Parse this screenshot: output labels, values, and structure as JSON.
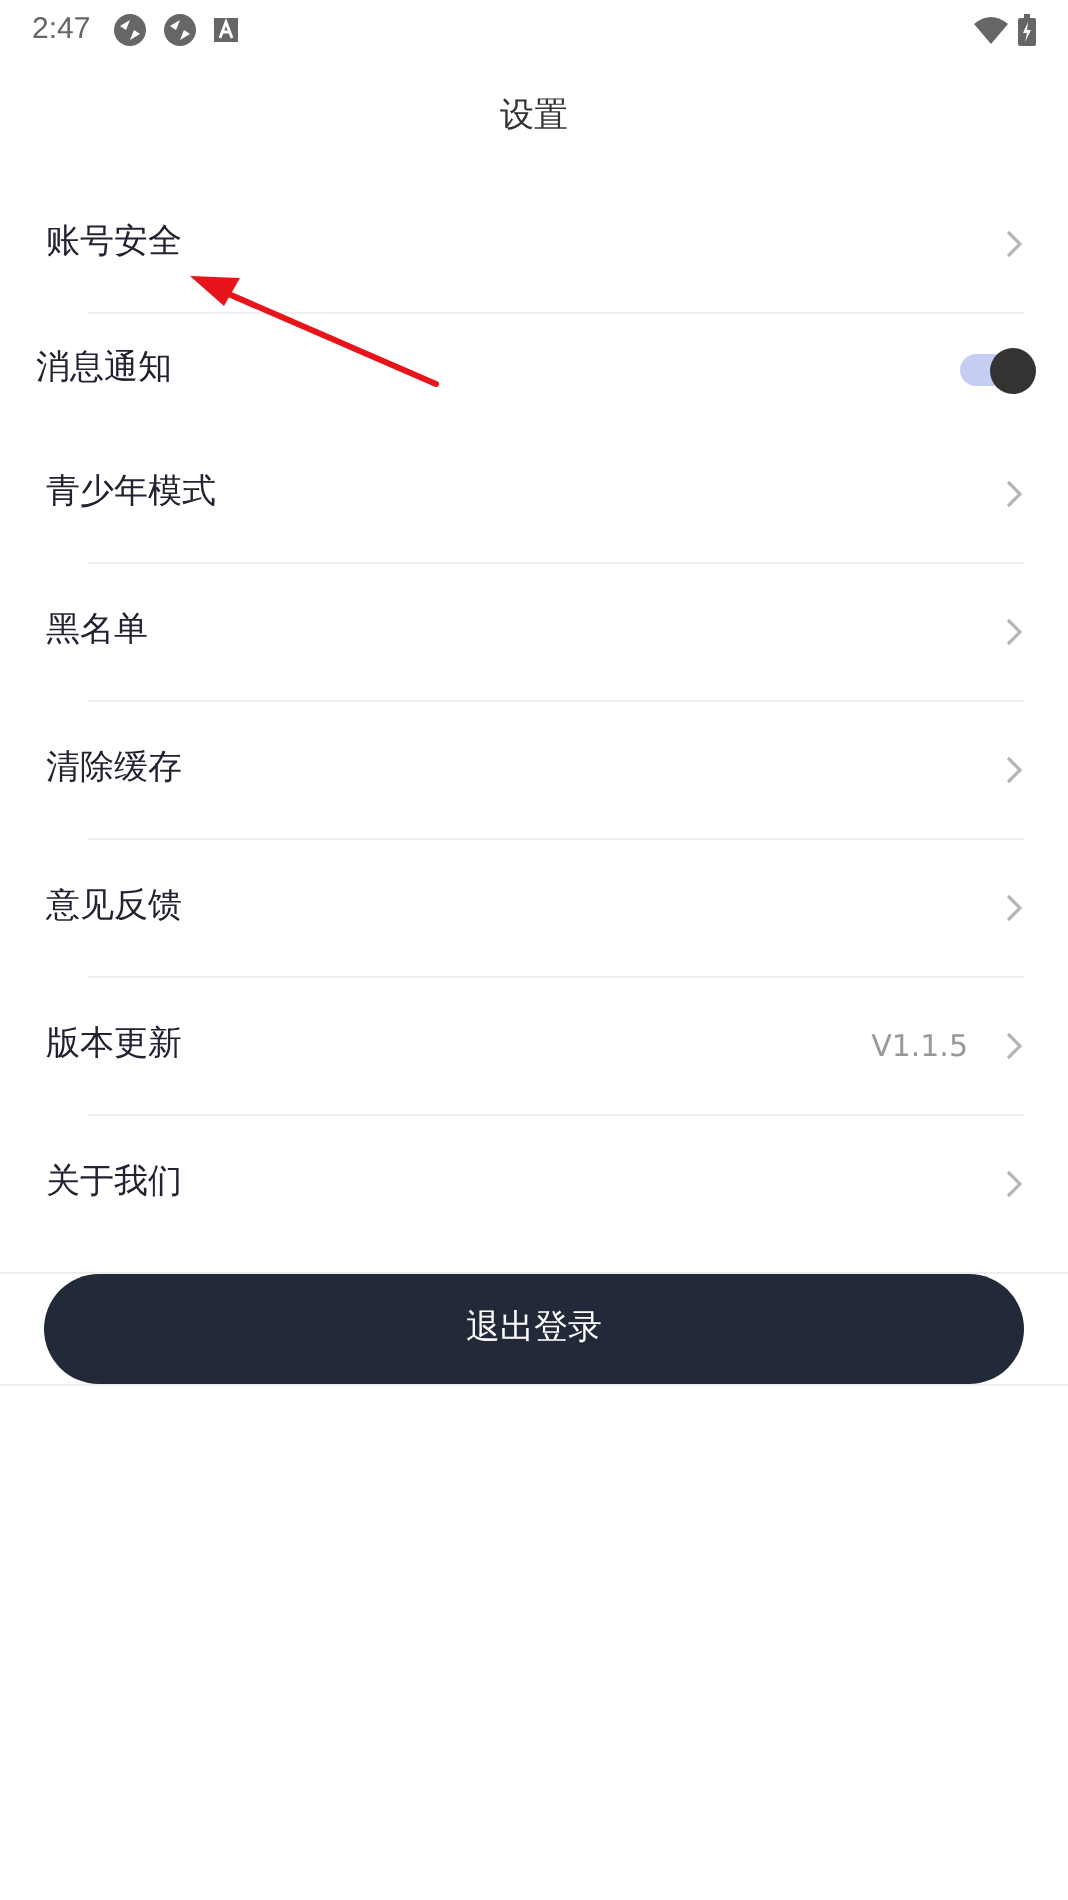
{
  "status_bar": {
    "time": "2:47"
  },
  "header": {
    "title": "设置"
  },
  "items": [
    {
      "kind": "link",
      "label": "账号安全"
    },
    {
      "kind": "toggle",
      "label": "消息通知",
      "on": true
    },
    {
      "kind": "link",
      "label": "青少年模式"
    },
    {
      "kind": "link",
      "label": "黑名单"
    },
    {
      "kind": "link",
      "label": "清除缓存"
    },
    {
      "kind": "link",
      "label": "意见反馈"
    },
    {
      "kind": "link",
      "label": "版本更新",
      "value": "V1.1.5"
    },
    {
      "kind": "link",
      "label": "关于我们"
    }
  ],
  "logout_button": {
    "label": "退出登录"
  }
}
